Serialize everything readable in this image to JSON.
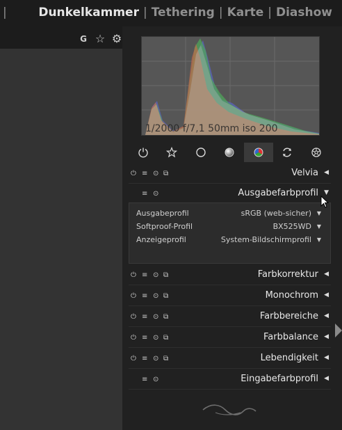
{
  "topbar": {
    "lead_sep": "|",
    "views": [
      {
        "label": "Dunkelkammer",
        "active": true
      },
      {
        "label": "Tethering",
        "active": false
      },
      {
        "label": "Karte",
        "active": false
      },
      {
        "label": "Diashow",
        "active": false
      }
    ],
    "sep": "|"
  },
  "header_icons": {
    "grouping": "G",
    "star": "☆",
    "gear": "⚙"
  },
  "histogram": {
    "exif": "1/2000 f/7,1 50mm iso 200"
  },
  "module_groups": [
    {
      "name": "power-icon",
      "active": false
    },
    {
      "name": "favorites-icon",
      "active": false
    },
    {
      "name": "basic-group-icon",
      "active": false
    },
    {
      "name": "tone-group-icon",
      "active": false
    },
    {
      "name": "color-group-icon",
      "active": true
    },
    {
      "name": "correction-group-icon",
      "active": false
    },
    {
      "name": "effects-group-icon",
      "active": false
    }
  ],
  "modules": {
    "velvia": "Velvia",
    "output": "Ausgabefarbprofil",
    "farbkorrektur": "Farbkorrektur",
    "monochrom": "Monochrom",
    "farbbereiche": "Farbbereiche",
    "farbbalance": "Farbbalance",
    "lebendigkeit": "Lebendigkeit",
    "eingabe": "Eingabefarbprofil"
  },
  "output_settings": {
    "profile_label": "Ausgabeprofil",
    "profile_value": "sRGB (web-sicher)",
    "softproof_label": "Softproof-Profil",
    "softproof_value": "BX525WD",
    "display_label": "Anzeigeprofil",
    "display_value": "System-Bildschirmprofil"
  },
  "icons": {
    "power": "⏻",
    "presets": "≡",
    "reset": "⊙",
    "multi": "⧉",
    "collapsed_arrow": "◀",
    "expanded_arrow": "▼",
    "dropdown": "▼"
  }
}
